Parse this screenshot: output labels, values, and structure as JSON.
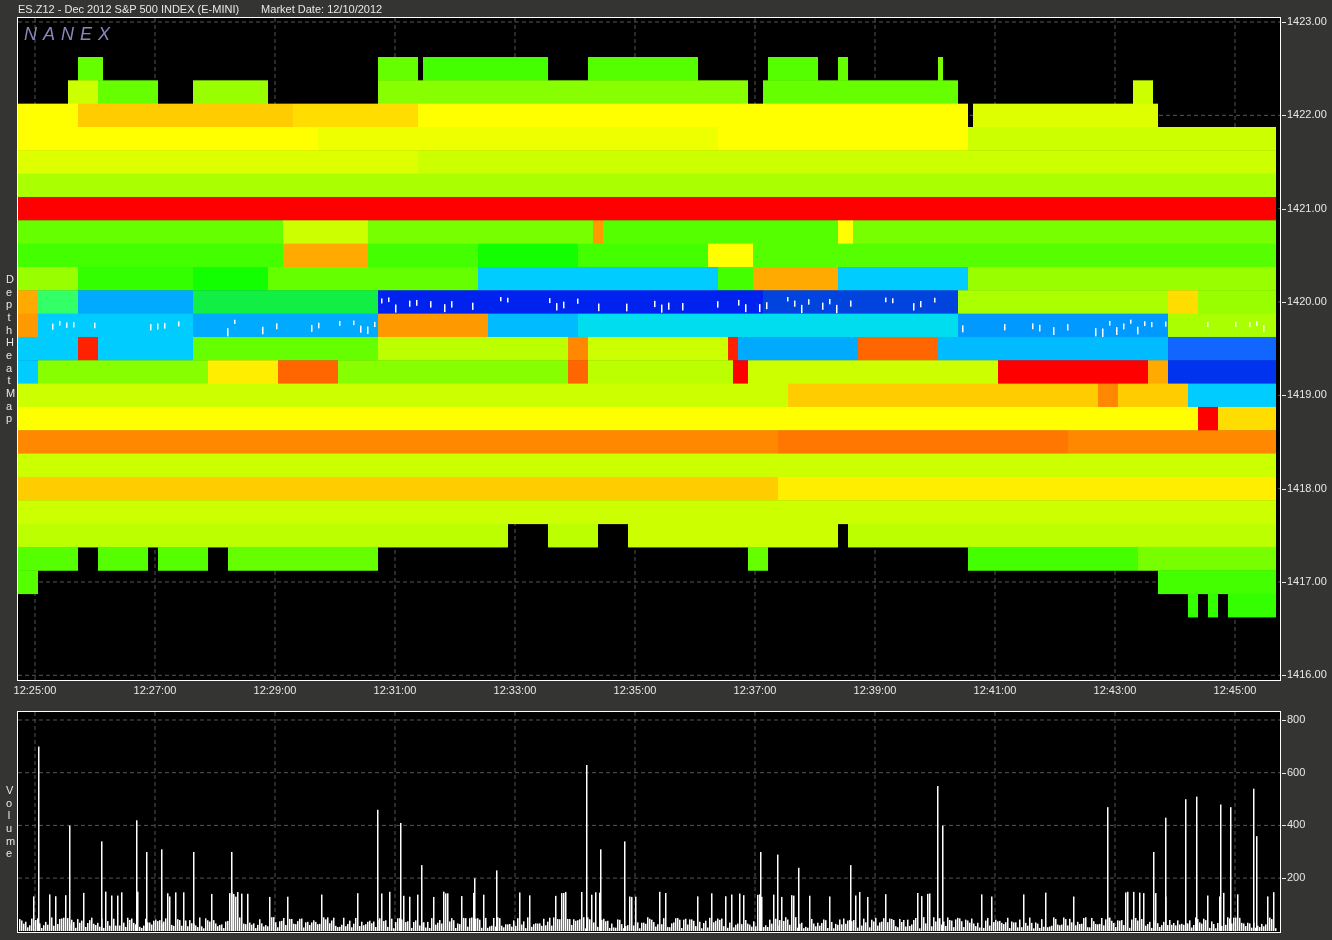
{
  "header": {
    "title": "ES.Z12 - Dec 2012 S&P 500 INDEX (E-MINI)",
    "market_date": "Market Date: 12/10/2012"
  },
  "heatmap": {
    "logo": "NANEX",
    "axis_label": "Depth Heat Map",
    "price_ticks": [
      "1423.00",
      "1422.00",
      "1421.00",
      "1420.00",
      "1419.00",
      "1418.00",
      "1417.00",
      "1416.00"
    ],
    "time_ticks": [
      "12:25:00",
      "12:27:00",
      "12:29:00",
      "12:31:00",
      "12:33:00",
      "12:35:00",
      "12:37:00",
      "12:39:00",
      "12:41:00",
      "12:43:00",
      "12:45:00"
    ]
  },
  "volume": {
    "axis_label": "Volume",
    "ticks": [
      "800",
      "600",
      "400",
      "200"
    ]
  }
}
